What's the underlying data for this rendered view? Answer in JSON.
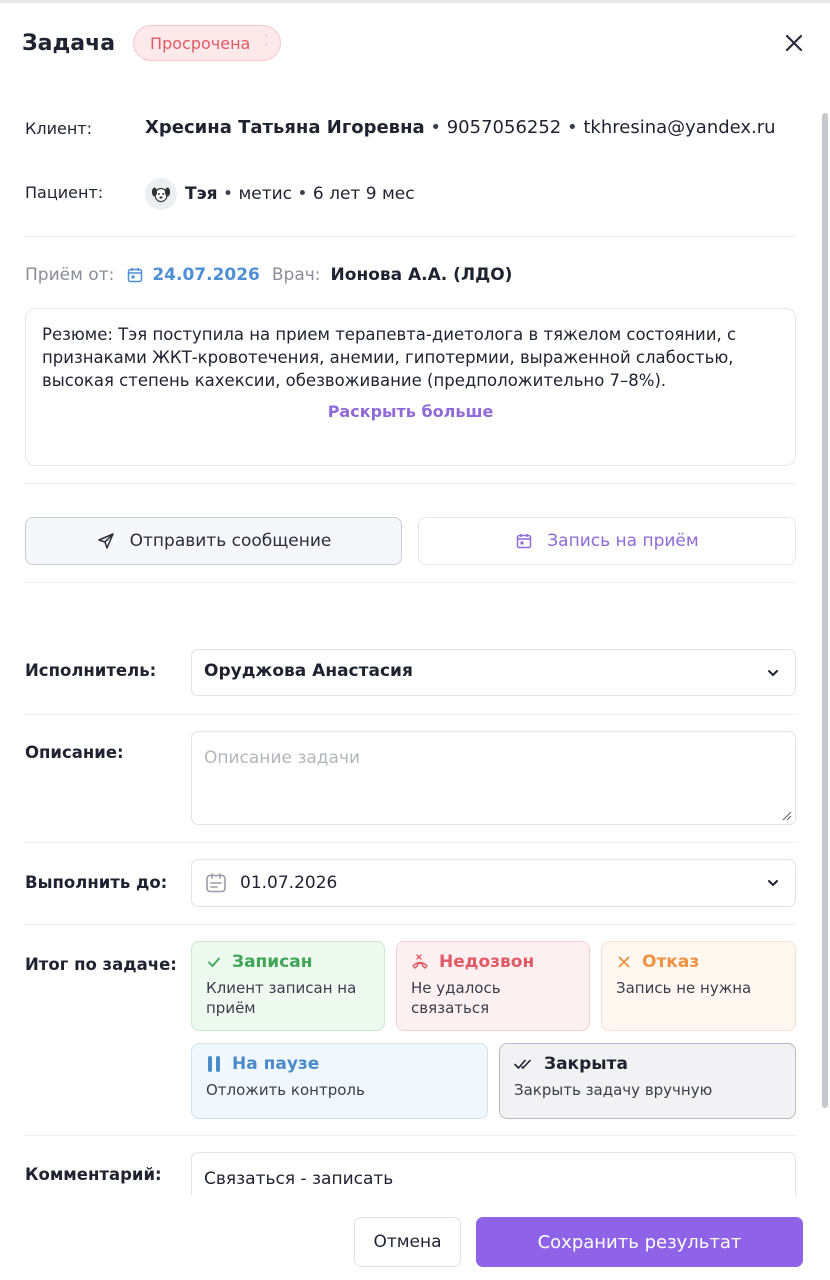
{
  "header": {
    "title": "Задача",
    "status_badge": "Просрочена"
  },
  "client": {
    "label": "Клиент:",
    "name": "Хресина Татьяна Игоревна",
    "phone": "9057056252",
    "email": "tkhresina@yandex.ru"
  },
  "patient": {
    "label": "Пациент:",
    "name": "Тэя",
    "breed": "метис",
    "age": "6 лет 9 мес"
  },
  "visit": {
    "label": "Приём от:",
    "date": "24.07.2026",
    "doctor_label": "Врач:",
    "doctor": "Ионова А.А. (ЛДО)"
  },
  "resume": {
    "text": "Резюме: Тэя поступила на прием терапевта-диетолога в тяжелом состоянии, с признаками ЖКТ-кровотечения, анемии, гипотермии, выраженной слабостью, высокая степень кахексии, обезвоживание (предположительно 7–8%).",
    "more_label": "Раскрыть больше"
  },
  "actions": {
    "send_message": "Отправить сообщение",
    "appointment": "Запись на приём"
  },
  "form": {
    "assignee_label": "Исполнитель:",
    "assignee_value": "Оруджова Анастасия",
    "description_label": "Описание:",
    "description_placeholder": "Описание задачи",
    "due_label": "Выполнить до:",
    "due_value": "01.07.2026",
    "result_label": "Итог по задаче:",
    "comment_label": "Комментарий:",
    "comment_value": "Связаться - записать"
  },
  "results": [
    {
      "title": "Записан",
      "desc": "Клиент записан на приём",
      "color": "#3ea655"
    },
    {
      "title": "Недозвон",
      "desc": "Не удалось связаться",
      "color": "#e05a66"
    },
    {
      "title": "Отказ",
      "desc": "Запись не нужна",
      "color": "#ee9140"
    },
    {
      "title": "На паузе",
      "desc": "Отложить контроль",
      "color": "#4a8cc9"
    },
    {
      "title": "Закрыта",
      "desc": "Закрыть задачу вручную",
      "color": "#1f2230"
    }
  ],
  "footer": {
    "cancel": "Отмена",
    "save": "Сохранить результат"
  },
  "colors": {
    "accent": "#8e63e8",
    "overdue": "#e05a66",
    "date_link": "#4f8fd6"
  }
}
